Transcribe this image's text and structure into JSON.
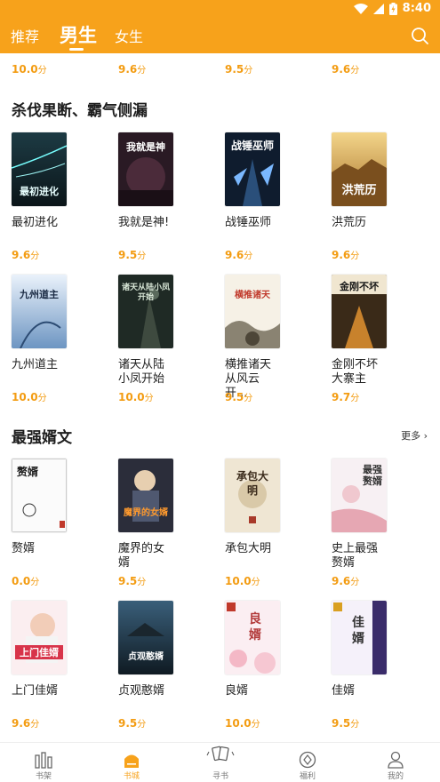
{
  "status": {
    "time": "8:40"
  },
  "tabs": [
    {
      "label": "推荐"
    },
    {
      "label": "男生"
    },
    {
      "label": "女生"
    }
  ],
  "prev_scores": [
    "10.0",
    "9.6",
    "9.5",
    "9.6"
  ],
  "score_unit": "分",
  "sections": [
    {
      "title": "杀伐果断、霸气侧漏",
      "books": [
        {
          "title": "最初进化",
          "score": "9.6",
          "cover_text": "最初进化"
        },
        {
          "title": "我就是神!",
          "score": "9.5",
          "cover_text": "我就是神"
        },
        {
          "title": "战锤巫师",
          "score": "9.6",
          "cover_text": "战锤巫师"
        },
        {
          "title": "洪荒历",
          "score": "9.6",
          "cover_text": "洪荒历"
        },
        {
          "title": "九州道主",
          "score": "10.0",
          "cover_text": "九州道主"
        },
        {
          "title": "诸天从陆小凤开始",
          "score": "10.0",
          "cover_text": "诸天从陆小凤开始"
        },
        {
          "title": "横推诸天从风云开...",
          "score": "9.5",
          "cover_text": "横推诸天"
        },
        {
          "title": "金刚不坏大寨主",
          "score": "9.7",
          "cover_text": "金刚不坏"
        }
      ]
    },
    {
      "title": "最强婿文",
      "more": "更多",
      "books": [
        {
          "title": "赘婿",
          "score": "0.0",
          "cover_text": "赘婿"
        },
        {
          "title": "魔界的女婿",
          "score": "9.5",
          "cover_text": "魔界的女婿"
        },
        {
          "title": "承包大明",
          "score": "10.0",
          "cover_text": "承包大明"
        },
        {
          "title": "史上最强赘婿",
          "score": "9.6",
          "cover_text": "最强赘婿"
        },
        {
          "title": "上门佳婿",
          "score": "9.6",
          "cover_text": "上门佳婿"
        },
        {
          "title": "贞观憨婿",
          "score": "9.5",
          "cover_text": "贞观憨婿"
        },
        {
          "title": "良婿",
          "score": "10.0",
          "cover_text": "良婿"
        },
        {
          "title": "佳婿",
          "score": "9.5",
          "cover_text": "佳婿"
        }
      ]
    }
  ],
  "bottom_nav": [
    {
      "label": "书架",
      "icon": "bookshelf-icon"
    },
    {
      "label": "书城",
      "icon": "bookstore-home-icon"
    },
    {
      "label": "寻书",
      "icon": "find-book-icon"
    },
    {
      "label": "福利",
      "icon": "welfare-icon"
    },
    {
      "label": "我的",
      "icon": "profile-icon"
    }
  ],
  "colors": {
    "accent": "#f7a21b",
    "score": "#f39c12"
  }
}
